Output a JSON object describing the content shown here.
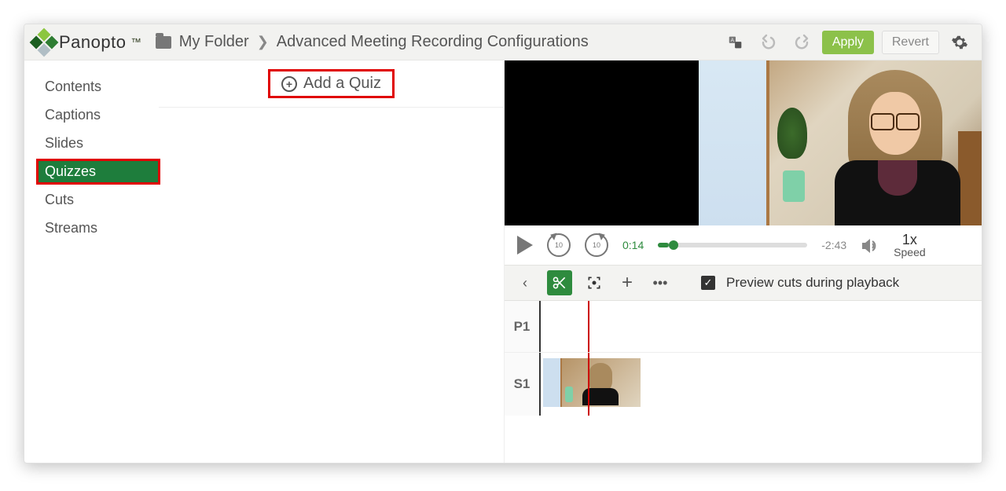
{
  "brand": "Panopto",
  "breadcrumb": {
    "folder_label": "My Folder",
    "page_title": "Advanced Meeting Recording Configurations"
  },
  "header_buttons": {
    "apply": "Apply",
    "revert": "Revert"
  },
  "sidebar": {
    "items": [
      {
        "label": "Contents"
      },
      {
        "label": "Captions"
      },
      {
        "label": "Slides"
      },
      {
        "label": "Quizzes",
        "active": true
      },
      {
        "label": "Cuts"
      },
      {
        "label": "Streams"
      }
    ]
  },
  "center": {
    "add_quiz_label": "Add a Quiz"
  },
  "player": {
    "skip_seconds": "10",
    "elapsed": "0:14",
    "remaining": "-2:43",
    "speed_value": "1x",
    "speed_label": "Speed"
  },
  "toolbar": {
    "preview_label": "Preview cuts during playback",
    "preview_checked": true
  },
  "timeline": {
    "tracks": [
      {
        "label": "P1"
      },
      {
        "label": "S1"
      }
    ]
  },
  "colors": {
    "accent_green": "#2e8b3e",
    "highlight_red": "#e00000"
  }
}
